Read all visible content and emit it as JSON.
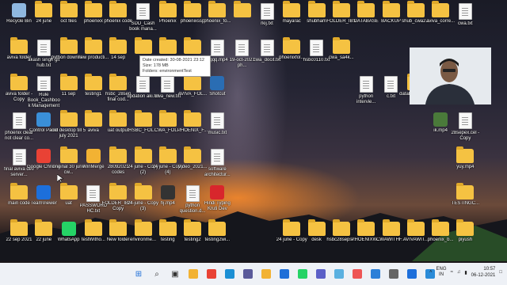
{
  "desktop": {
    "icons": [
      {
        "label": "Recycle Bin",
        "type": "app",
        "color": "#8fb8e0"
      },
      {
        "label": "24 june",
        "type": "folder"
      },
      {
        "label": "oct files",
        "type": "folder"
      },
      {
        "label": "phoenixx",
        "type": "folder"
      },
      {
        "label": "phoenix code",
        "type": "folder"
      },
      {
        "label": "SDD_Cash book mana...",
        "type": "doc"
      },
      {
        "label": "Phoenix",
        "type": "folder"
      },
      {
        "label": "phoenixssp",
        "type": "folder"
      },
      {
        "label": "phoenix_fo...",
        "type": "folder"
      },
      {
        "label": "",
        "type": "folder"
      },
      {
        "label": "rkij.txt",
        "type": "doc"
      },
      {
        "label": "mayarac",
        "type": "folder"
      },
      {
        "label": "shubham",
        "type": "folder"
      },
      {
        "label": "FOLDER_IBS",
        "type": "folder"
      },
      {
        "label": "DATABASE",
        "type": "folder"
      },
      {
        "label": "BACKUP",
        "type": "folder"
      },
      {
        "label": "shub_cwa2...",
        "type": "folder"
      },
      {
        "label": "aviva_corre...",
        "type": "folder"
      },
      {
        "label": "cwa.txt",
        "type": "doc"
      },
      {
        "label": "aviva folder",
        "type": "folder"
      },
      {
        "label": "akash singh git hub.txt",
        "type": "doc"
      },
      {
        "label": "python downlo...",
        "type": "folder"
      },
      {
        "label": "new producti...",
        "type": "folder"
      },
      {
        "label": "14 sep",
        "type": "folder"
      },
      {
        "label": "",
        "type": "folder"
      },
      {
        "label": "fn_recog...",
        "type": "folder"
      },
      {
        "label": "python program",
        "type": "folder"
      },
      {
        "label": "qqqq.mp4",
        "type": "doc"
      },
      {
        "label": "19-oct-2021 ph...",
        "type": "doc"
      },
      {
        "label": "cwa_docit.txt",
        "type": "doc"
      },
      {
        "label": "phoenixfol...",
        "type": "folder"
      },
      {
        "label": "hsbc0110.txt",
        "type": "doc"
      },
      {
        "label": "cwa_sa4k...",
        "type": "folder"
      },
      {
        "label": "aviva folder - Copy",
        "type": "folder"
      },
      {
        "label": "Rule Book_Cashbook Management",
        "type": "doc"
      },
      {
        "label": "11 sep",
        "type": "folder"
      },
      {
        "label": "testing1",
        "type": "folder"
      },
      {
        "label": "hsbc_28sep final cod...",
        "type": "folder"
      },
      {
        "label": "updation aki.txt",
        "type": "doc"
      },
      {
        "label": "cwa_new.txt",
        "type": "doc"
      },
      {
        "label": "AVIVA_FOL...",
        "type": "folder"
      },
      {
        "label": "Shotcut",
        "type": "app",
        "color": "#2a6db3"
      },
      {
        "label": "python intervie...",
        "type": "doc"
      },
      {
        "label": "c.txt",
        "type": "doc"
      },
      {
        "label": "database folder",
        "type": "folder"
      },
      {
        "label": "ph",
        "type": "folder"
      },
      {
        "label": "28sepex.cel",
        "type": "doc"
      },
      {
        "label": "phoenix clear not clear co...",
        "type": "doc"
      },
      {
        "label": "Control Panel",
        "type": "app",
        "color": "#3a8fd8"
      },
      {
        "label": "old desktop till 5 july 2021",
        "type": "folder"
      },
      {
        "label": "aviva",
        "type": "folder"
      },
      {
        "label": "uat output",
        "type": "folder"
      },
      {
        "label": "HSBC_FOL...",
        "type": "folder"
      },
      {
        "label": "CWA_FOL...",
        "type": "folder"
      },
      {
        "label": "PHOENIX_F...",
        "type": "folder"
      },
      {
        "label": "music.txt",
        "type": "doc"
      },
      {
        "label": "ik.mp4",
        "type": "app",
        "color": "#4a7a3a"
      },
      {
        "label": "28sepex.cel - Copy",
        "type": "doc"
      },
      {
        "label": "final aviva dev server...",
        "type": "doc"
      },
      {
        "label": "Google Chrome",
        "type": "app",
        "color": "#e94235"
      },
      {
        "label": "original 30 june cw...",
        "type": "folder"
      },
      {
        "label": "WinMerge",
        "type": "app",
        "color": "#f2b233"
      },
      {
        "label": "28092021 codes",
        "type": "folder"
      },
      {
        "label": "24 june - Copy (2)",
        "type": "folder"
      },
      {
        "label": "24 june - Copy (4)",
        "type": "folder"
      },
      {
        "label": "Video_2021...",
        "type": "folder"
      },
      {
        "label": "software architectur...",
        "type": "doc"
      },
      {
        "label": "yuy.mp4",
        "type": "folder"
      },
      {
        "label": "main code",
        "type": "folder"
      },
      {
        "label": "TeamViewer",
        "type": "app",
        "color": "#1d6fdb"
      },
      {
        "label": "uat",
        "type": "folder"
      },
      {
        "label": "PASSWORD HC.txt",
        "type": "doc"
      },
      {
        "label": "FOLDER_IBS - Copy",
        "type": "folder"
      },
      {
        "label": "24 june - Copy (3)",
        "type": "folder"
      },
      {
        "label": "hj.mp4",
        "type": "app",
        "color": "#333"
      },
      {
        "label": "python question.d...",
        "type": "doc"
      },
      {
        "label": "Hindi Typing Kruti Dev",
        "type": "app",
        "color": "#d8262c"
      },
      {
        "label": "TESTINGC...",
        "type": "folder"
      },
      {
        "label": "22 sep 2021",
        "type": "folder"
      },
      {
        "label": "22 june",
        "type": "folder"
      },
      {
        "label": "WhatsApp",
        "type": "app",
        "color": "#25d366"
      },
      {
        "label": "testWitho...",
        "type": "folder"
      },
      {
        "label": "New folder",
        "type": "folder"
      },
      {
        "label": "environme...",
        "type": "folder"
      },
      {
        "label": "testing",
        "type": "folder"
      },
      {
        "label": "testing2",
        "type": "folder"
      },
      {
        "label": "testing2wi...",
        "type": "folder"
      },
      {
        "label": "24 june - Copy",
        "type": "folder"
      },
      {
        "label": "desk",
        "type": "folder"
      },
      {
        "label": "hsbc28seps...",
        "type": "folder"
      },
      {
        "label": "PHOENIXW...",
        "type": "folder"
      },
      {
        "label": "CWAWITHF...",
        "type": "folder"
      },
      {
        "label": "AVIVAWIT...",
        "type": "folder"
      },
      {
        "label": "phoenix_b...",
        "type": "folder"
      },
      {
        "label": "piyush",
        "type": "folder"
      }
    ]
  },
  "tooltip": {
    "line1": "Date created: 30-08-2021 23:12",
    "line2": "Size: 178 MB",
    "line3": "Folders: environmentTest"
  },
  "taskbar": {
    "apps": [
      "windows-start",
      "search",
      "task-view",
      "explorer",
      "chrome",
      "edge",
      "store",
      "files",
      "mail",
      "whatsapp",
      "teams",
      "notepad",
      "code",
      "photos",
      "settings",
      "teamviewer",
      "vscode"
    ],
    "language": "ENG",
    "region": "IN",
    "time": "10:57",
    "date": "06-12-2021"
  }
}
